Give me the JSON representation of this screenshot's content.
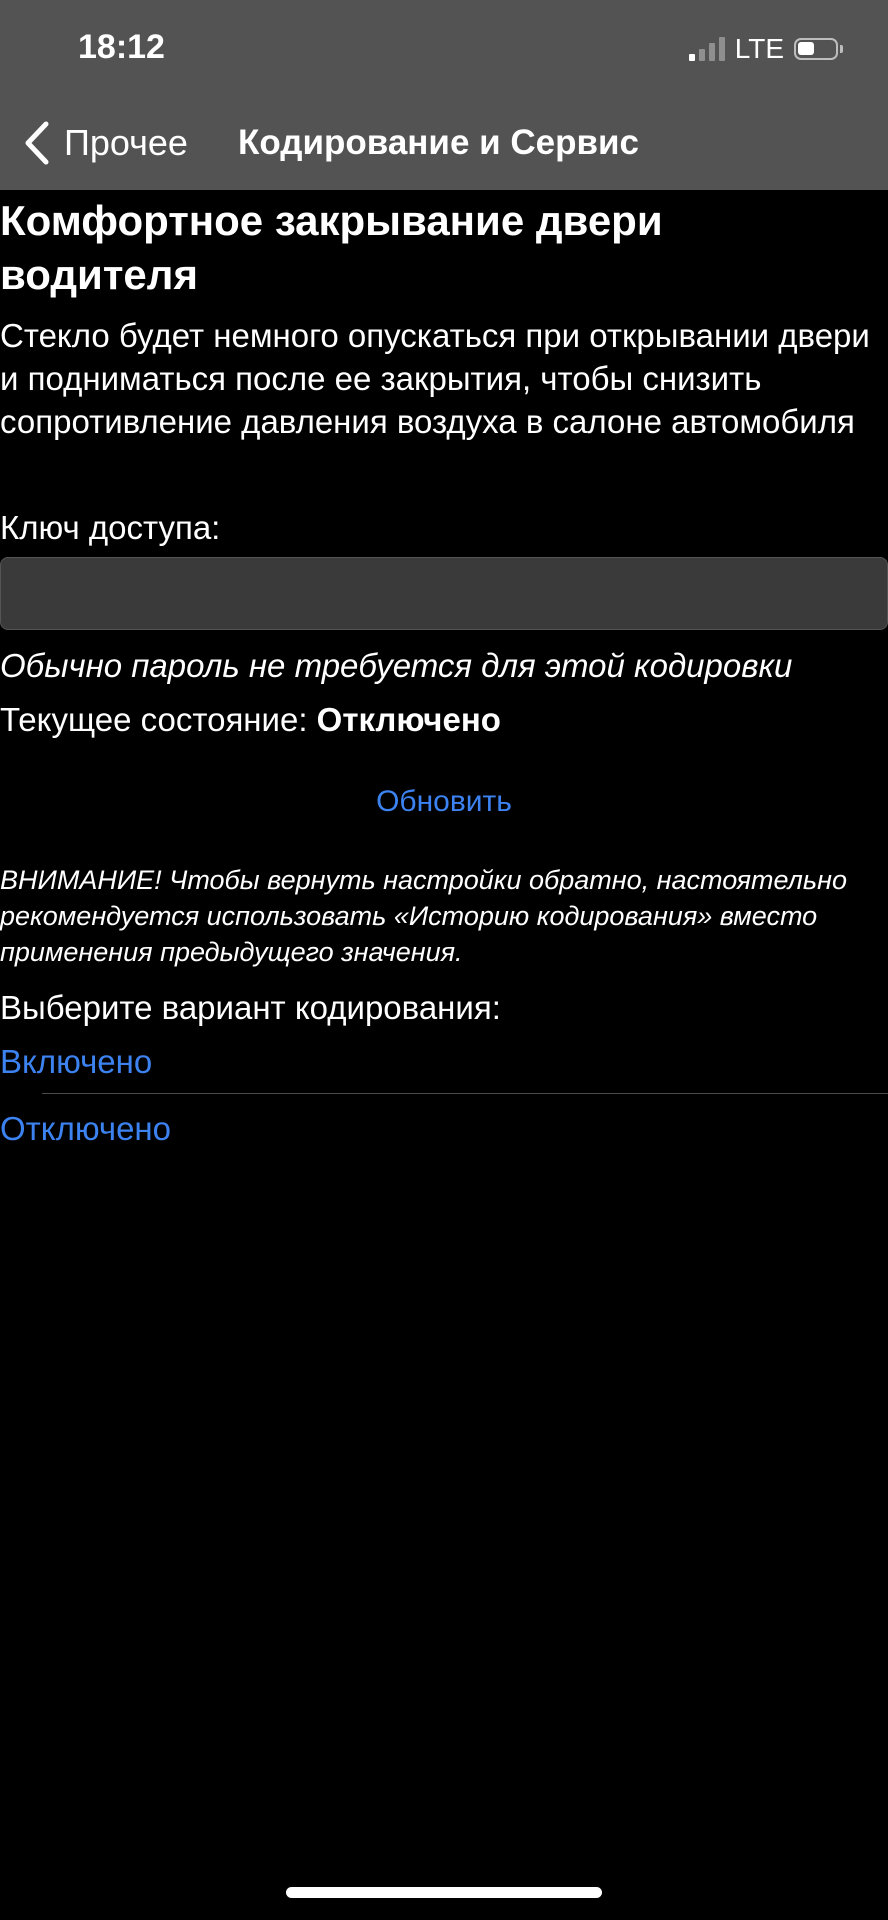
{
  "status_bar": {
    "time": "18:12",
    "network": "LTE",
    "signal_bars_active": 1,
    "signal_bars_total": 4,
    "battery_level": 0.45
  },
  "nav": {
    "back_label": "Прочее",
    "title": "Кодирование и Сервис"
  },
  "content": {
    "title": "Комфортное закрывание двери водителя",
    "description": "Стекло будет немного опускаться при открывании двери и подниматься после ее закрытия, чтобы снизить сопротивление давления воздуха в салоне автомобиля",
    "key_label": "Ключ доступа:",
    "key_value": "",
    "key_hint": "Обычно пароль не требуется для этой кодировки",
    "state_label": "Текущее состояние: ",
    "state_value": "Отключено",
    "refresh_label": "Обновить",
    "warning": "ВНИМАНИЕ! Чтобы вернуть настройки обратно, настоятельно рекомендуется использовать «Историю кодирования» вместо применения предыдущего значения.",
    "choose_label": "Выберите вариант кодирования:",
    "options": [
      "Включено",
      "Отключено"
    ]
  },
  "colors": {
    "background": "#000000",
    "header": "#535353",
    "accent": "#3c82f0",
    "input_bg": "#3a3a3a"
  }
}
